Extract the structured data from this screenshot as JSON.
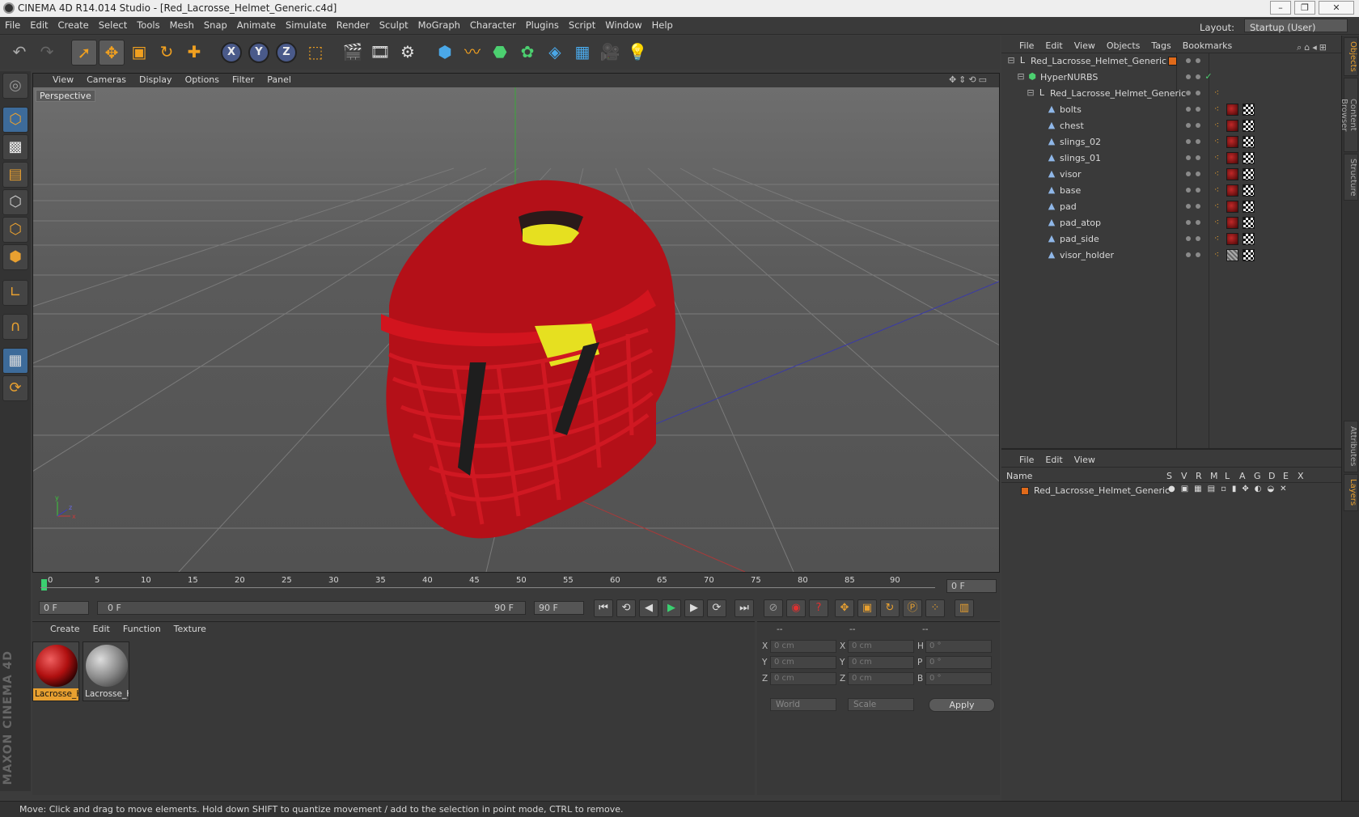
{
  "window": {
    "title": "CINEMA 4D R14.014 Studio - [Red_Lacrosse_Helmet_Generic.c4d]"
  },
  "menubar": {
    "items": [
      "File",
      "Edit",
      "Create",
      "Select",
      "Tools",
      "Mesh",
      "Snap",
      "Animate",
      "Simulate",
      "Render",
      "Sculpt",
      "MoGraph",
      "Character",
      "Plugins",
      "Script",
      "Window",
      "Help"
    ],
    "layout_label": "Layout:",
    "layout_value": "Startup (User)"
  },
  "toolbar": {
    "axis_x": "X",
    "axis_y": "Y",
    "axis_z": "Z"
  },
  "viewport": {
    "menu": [
      "View",
      "Cameras",
      "Display",
      "Options",
      "Filter",
      "Panel"
    ],
    "label": "Perspective"
  },
  "timeline": {
    "ticks": [
      "0",
      "5",
      "10",
      "15",
      "20",
      "25",
      "30",
      "35",
      "40",
      "45",
      "50",
      "55",
      "60",
      "65",
      "70",
      "75",
      "80",
      "85",
      "90"
    ],
    "current_frame": "0 F"
  },
  "playbar": {
    "start": "0 F",
    "range_start": "0 F",
    "range_end": "90 F",
    "end": "90 F"
  },
  "material_manager": {
    "menu": [
      "Create",
      "Edit",
      "Function",
      "Texture"
    ],
    "materials": [
      {
        "name": "Lacrosse_H",
        "selected": true
      },
      {
        "name": "Lacrosse_H",
        "selected": false
      }
    ]
  },
  "coordinates": {
    "header": [
      "--",
      "--",
      "--"
    ],
    "rows": [
      {
        "l1": "X",
        "v1": "0 cm",
        "l2": "X",
        "v2": "0 cm",
        "l3": "H",
        "v3": "0 °"
      },
      {
        "l1": "Y",
        "v1": "0 cm",
        "l2": "Y",
        "v2": "0 cm",
        "l3": "P",
        "v3": "0 °"
      },
      {
        "l1": "Z",
        "v1": "0 cm",
        "l2": "Z",
        "v2": "0 cm",
        "l3": "B",
        "v3": "0 °"
      }
    ],
    "mode": "World",
    "transform": "Scale",
    "apply": "Apply"
  },
  "object_manager": {
    "menu": [
      "File",
      "Edit",
      "View",
      "Objects",
      "Tags",
      "Bookmarks"
    ],
    "objects": [
      {
        "name": "Red_Lacrosse_Helmet_Generic",
        "indent": 0,
        "icon": "null-icon"
      },
      {
        "name": "HyperNURBS",
        "indent": 1,
        "icon": "hypernurbs-icon"
      },
      {
        "name": "Red_Lacrosse_Helmet_Generic",
        "indent": 2,
        "icon": "null-icon"
      },
      {
        "name": "bolts",
        "indent": 3,
        "icon": "polygon-icon"
      },
      {
        "name": "chest",
        "indent": 3,
        "icon": "polygon-icon"
      },
      {
        "name": "slings_02",
        "indent": 3,
        "icon": "polygon-icon"
      },
      {
        "name": "slings_01",
        "indent": 3,
        "icon": "polygon-icon"
      },
      {
        "name": "visor",
        "indent": 3,
        "icon": "polygon-icon"
      },
      {
        "name": "base",
        "indent": 3,
        "icon": "polygon-icon"
      },
      {
        "name": "pad",
        "indent": 3,
        "icon": "polygon-icon"
      },
      {
        "name": "pad_atop",
        "indent": 3,
        "icon": "polygon-icon"
      },
      {
        "name": "pad_side",
        "indent": 3,
        "icon": "polygon-icon"
      },
      {
        "name": "visor_holder",
        "indent": 3,
        "icon": "polygon-icon"
      }
    ]
  },
  "layer_manager": {
    "menu": [
      "File",
      "Edit",
      "View"
    ],
    "columns": [
      "Name",
      "S",
      "V",
      "R",
      "M",
      "L",
      "A",
      "G",
      "D",
      "E",
      "X"
    ],
    "layers": [
      {
        "name": "Red_Lacrosse_Helmet_Generic",
        "color": "#e06a1a"
      }
    ]
  },
  "side_tabs": [
    "Objects",
    "Content Browser",
    "Structure",
    "Attributes",
    "Layers"
  ],
  "logo": {
    "text": "MAXON CINEMA 4D"
  },
  "status": {
    "text": "Move: Click and drag to move elements. Hold down SHIFT to quantize movement / add to the selection in point mode, CTRL to remove."
  },
  "colors": {
    "accent": "#e8a030",
    "selection": "#3d6b9a",
    "helmet": "#c4121e",
    "pad": "#e8e020"
  }
}
